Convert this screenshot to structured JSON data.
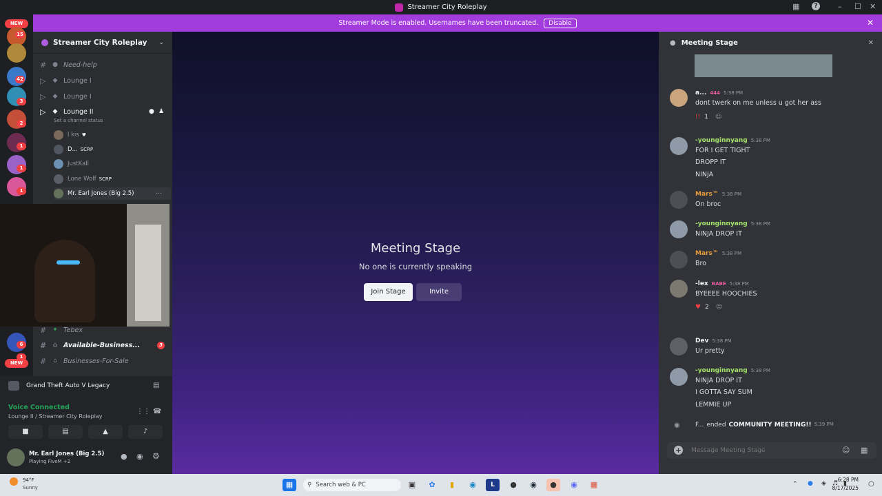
{
  "window": {
    "title": "Streamer City Roleplay"
  },
  "banner": {
    "text": "Streamer Mode is enabled. Usernames have been truncated.",
    "button": "Disable"
  },
  "rail": {
    "new_top": "NEW",
    "new_bottom": "NEW",
    "badges": [
      "15",
      "42",
      "3",
      "2",
      "1",
      "1",
      "1",
      "6",
      "1"
    ]
  },
  "server": {
    "name": "Streamer City Roleplay"
  },
  "channels": [
    {
      "label": "Need-help"
    },
    {
      "label": "Lounge I"
    },
    {
      "label": "Lounge I"
    },
    {
      "label": "Lounge II"
    }
  ],
  "channel_status": "Set a channel status",
  "voice_users": [
    {
      "name": "l kis",
      "tag": ""
    },
    {
      "name": "D...",
      "tag": "SCRP"
    },
    {
      "name": "JustKall",
      "tag": ""
    },
    {
      "name": "Lone Wolf",
      "tag": "SCRP"
    },
    {
      "name": "Mr. Earl Jones (Big 2.5)",
      "tag": ""
    }
  ],
  "lower_channels": [
    {
      "label": "Tebex",
      "badge": ""
    },
    {
      "label": "Available-Business...",
      "badge": "3"
    },
    {
      "label": "Businesses-For-Sale",
      "badge": ""
    }
  ],
  "game": {
    "name": "Grand Theft Auto V Legacy"
  },
  "voice": {
    "status": "Voice Connected",
    "channel": "Lounge II / Streamer City Roleplay"
  },
  "account": {
    "name": "Mr. Earl Jones (Big 2.5)",
    "activity": "Playing FiveM +2"
  },
  "stage": {
    "title": "Meeting Stage",
    "subtitle": "No one is currently speaking",
    "join": "Join Stage",
    "invite": "Invite"
  },
  "chat": {
    "header": "Meeting Stage",
    "placeholder": "Message Meeting Stage",
    "messages": [
      {
        "name": "a...",
        "extra": "444",
        "time": "5:38 PM",
        "color": "#f2f3f5",
        "lines": [
          "dont twerk on me unless u got her ass"
        ],
        "reaction": "1"
      },
      {
        "name": "-younginnyang",
        "extra": "",
        "time": "5:38 PM",
        "color": "#a4e36b",
        "lines": [
          "FOR I GET TIGHT",
          "DROPP IT",
          "NINJA"
        ],
        "reaction": ""
      },
      {
        "name": "Mars™",
        "extra": "",
        "time": "5:38 PM",
        "color": "#e79b3b",
        "lines": [
          "On broc"
        ],
        "reaction": ""
      },
      {
        "name": "-younginnyang",
        "extra": "",
        "time": "5:38 PM",
        "color": "#a4e36b",
        "lines": [
          "NINJA DROP IT"
        ],
        "reaction": ""
      },
      {
        "name": "Mars™",
        "extra": "",
        "time": "5:38 PM",
        "color": "#e79b3b",
        "lines": [
          "Bro"
        ],
        "reaction": ""
      },
      {
        "name": "-lex",
        "extra": "BABE",
        "time": "5:38 PM",
        "color": "#f2f3f5",
        "lines": [
          "BYEEEE HOOCHIES"
        ],
        "reaction": "2"
      },
      {
        "name": "Dev",
        "extra": "",
        "time": "5:38 PM",
        "color": "#f2f3f5",
        "lines": [
          "Ur pretty"
        ],
        "reaction": ""
      },
      {
        "name": "-younginnyang",
        "extra": "",
        "time": "5:38 PM",
        "color": "#a4e36b",
        "lines": [
          "NINJA DROP IT",
          "I GOTTA SAY SUM",
          "LEMMIE UP"
        ],
        "reaction": ""
      }
    ],
    "system": {
      "user": "F...",
      "text": "ended",
      "event": "COMMUNITY MEETING!!",
      "time": "5:39 PM"
    }
  },
  "taskbar": {
    "weather_temp": "94°F",
    "weather_desc": "Sunny",
    "search": "Search web & PC",
    "time": "6:28 PM",
    "date": "8/17/2025"
  }
}
